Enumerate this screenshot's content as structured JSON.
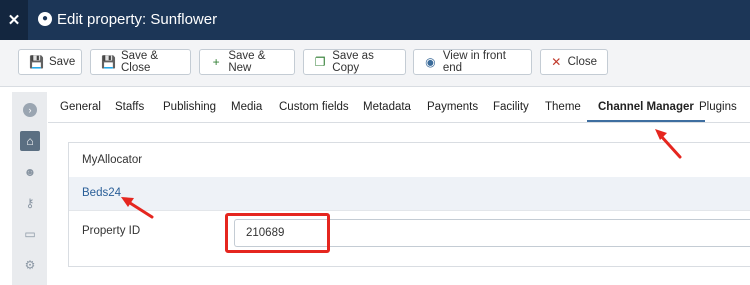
{
  "header": {
    "logo_glyph": "✕",
    "title_icon_glyph": "●",
    "title": "Edit property: Sunflower"
  },
  "toolbar": {
    "save": "Save",
    "save_close": "Save & Close",
    "save_new": "Save & New",
    "save_copy": "Save as Copy",
    "view_front": "View in front end",
    "close": "Close"
  },
  "toolbar_icons": {
    "save": "💾",
    "save_close": "💾",
    "save_new": "+",
    "save_copy": "❐",
    "view_front": "◉",
    "close": "✕"
  },
  "sidebar_icons": {
    "toggle": "›",
    "home": "⌂",
    "users": "☻",
    "key": "⚷",
    "ticket": "▭",
    "gears": "⚙"
  },
  "tabs": [
    "General",
    "Staffs",
    "Publishing",
    "Media",
    "Custom fields",
    "Metadata",
    "Payments",
    "Facility",
    "Theme",
    "Channel Manager",
    "Plugins"
  ],
  "channel_manager": {
    "providers": [
      "MyAllocator",
      "Beds24"
    ],
    "field_label": "Property ID",
    "field_value": "210689"
  },
  "colors": {
    "header_bg": "#1c3657",
    "accent": "#3e6ea0",
    "annotation": "#e5261f"
  }
}
